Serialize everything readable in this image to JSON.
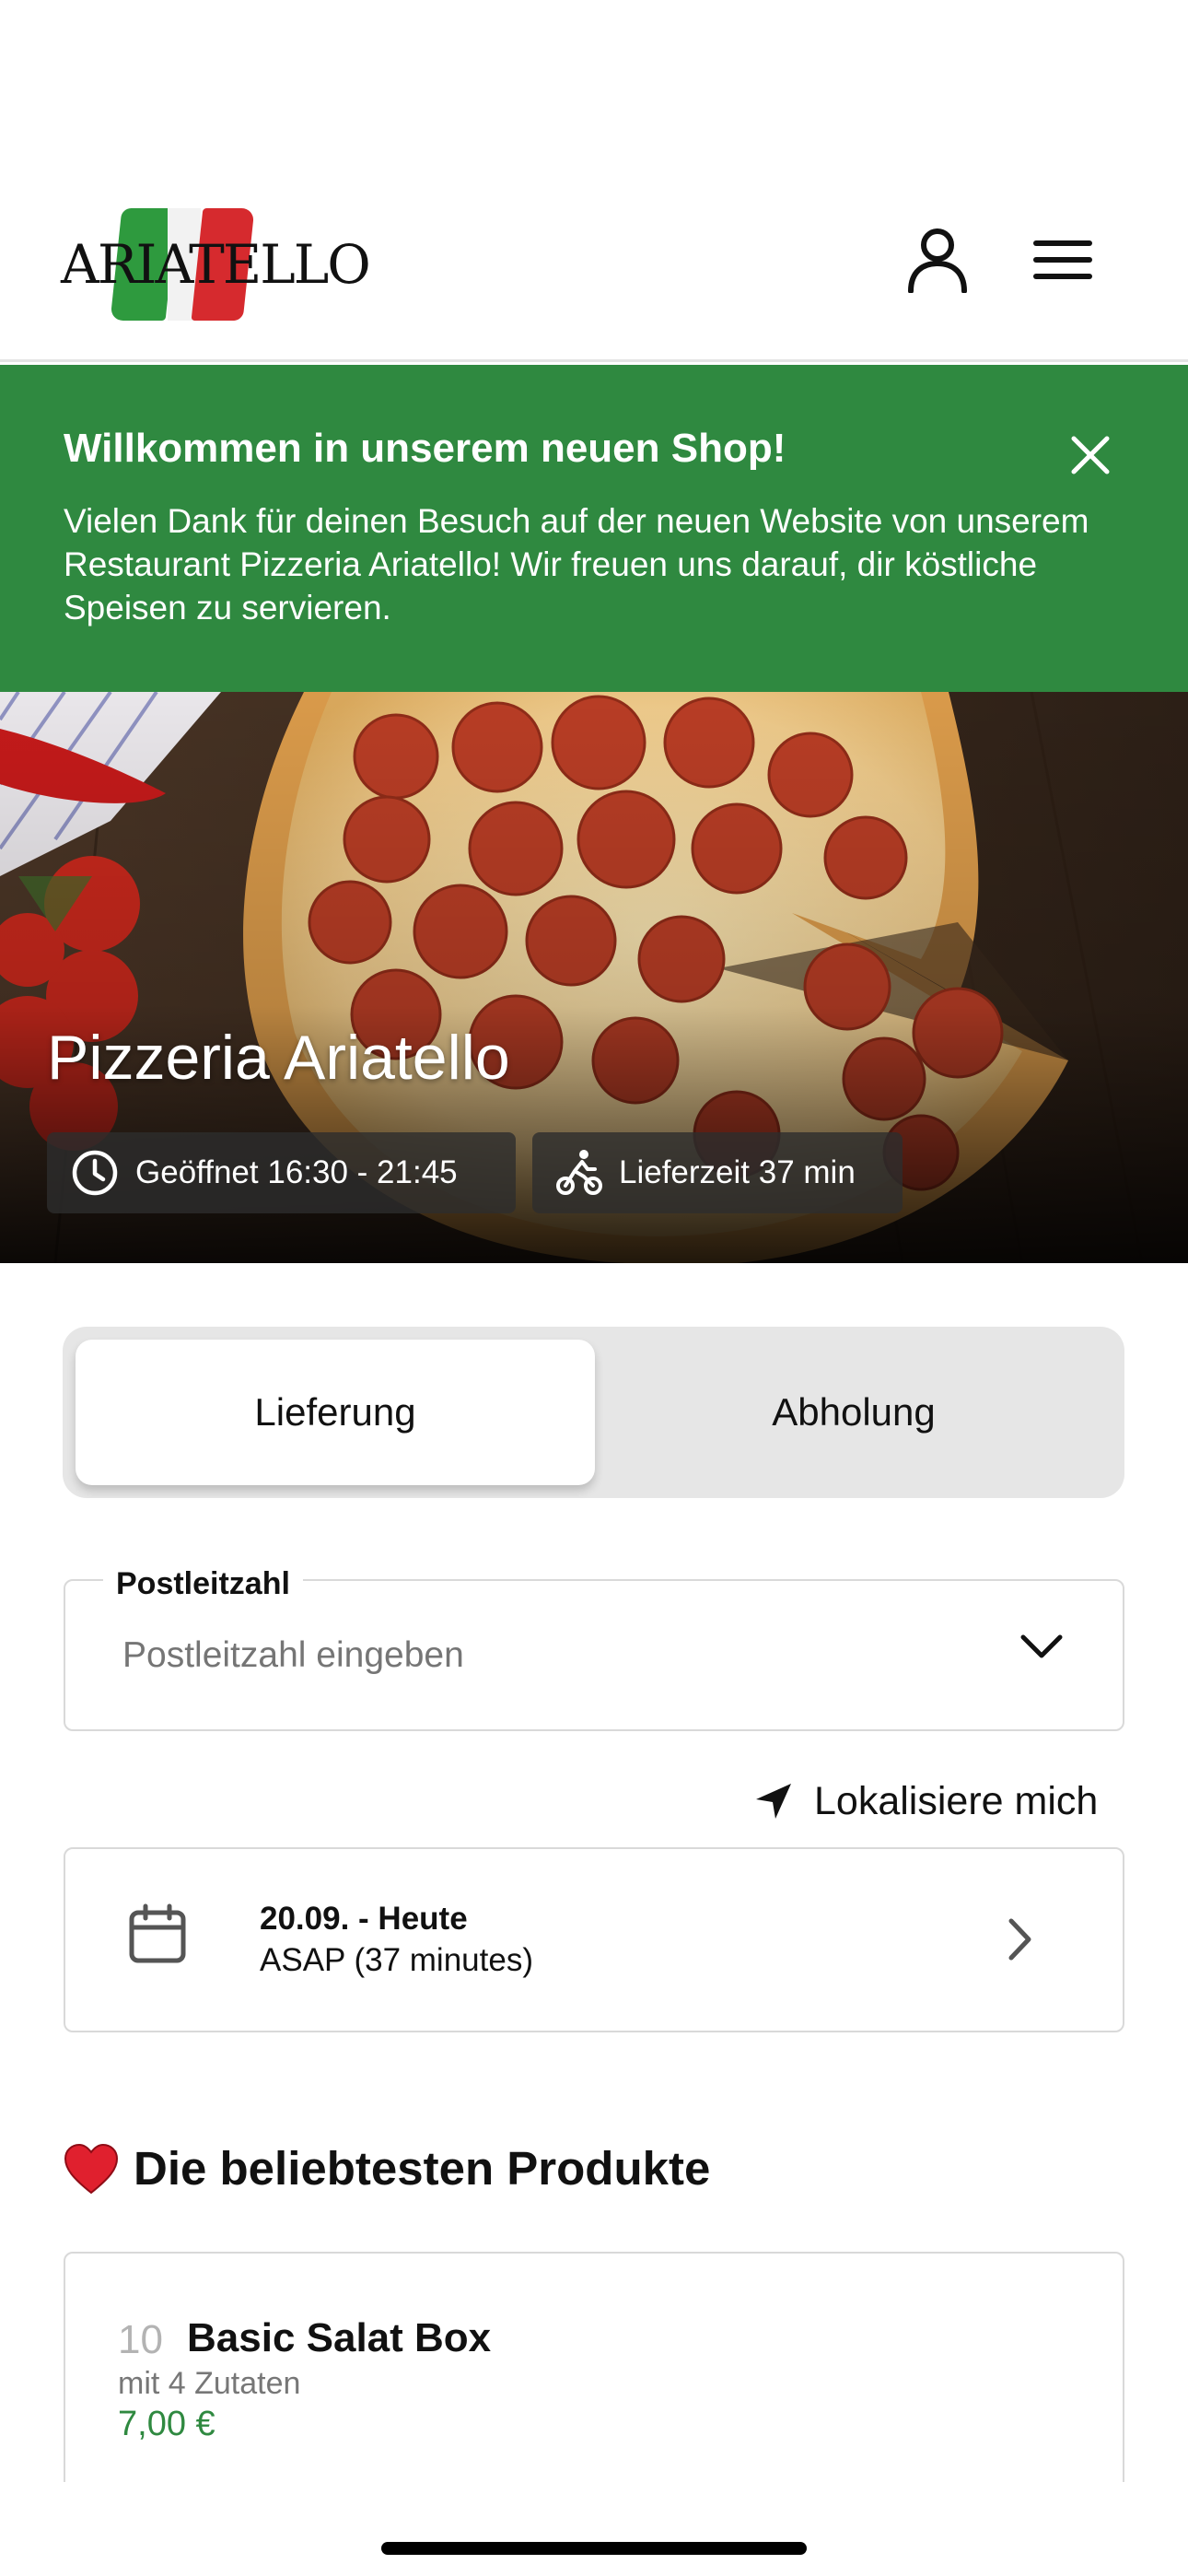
{
  "header": {
    "logo_text": "ARIATELLO",
    "icons": {
      "user": "user-icon",
      "menu": "hamburger-menu-icon"
    }
  },
  "banner": {
    "title": "Willkommen in unserem neuen Shop!",
    "text": "Vielen Dank für deinen Besuch auf der neuen Website von unserem Restaurant Pizzeria Ariatello! Wir freuen uns darauf, dir köstliche Speisen zu servieren.",
    "close_icon": "close-icon",
    "bg_color": "#2f8940"
  },
  "hero": {
    "title": "Pizzeria Ariatello",
    "open_hours": "Geöffnet 16:30 - 21:45",
    "delivery_time": "Lieferzeit 37 min"
  },
  "tabs": [
    {
      "label": "Lieferung",
      "active": true
    },
    {
      "label": "Abholung",
      "active": false
    }
  ],
  "postcode": {
    "label": "Postleitzahl",
    "placeholder": "Postleitzahl eingeben",
    "value": ""
  },
  "locate": {
    "label": "Lokalisiere mich"
  },
  "date": {
    "line1": "20.09. - Heute",
    "line2": "ASAP (37 minutes)"
  },
  "section": {
    "title": "Die beliebtesten Produkte"
  },
  "products": [
    {
      "number": "10",
      "name": "Basic Salat Box",
      "description": "mit 4 Zutaten",
      "price": "7,00 €"
    }
  ],
  "colors": {
    "accent_green": "#2f8940",
    "price_green": "#2f8940"
  }
}
